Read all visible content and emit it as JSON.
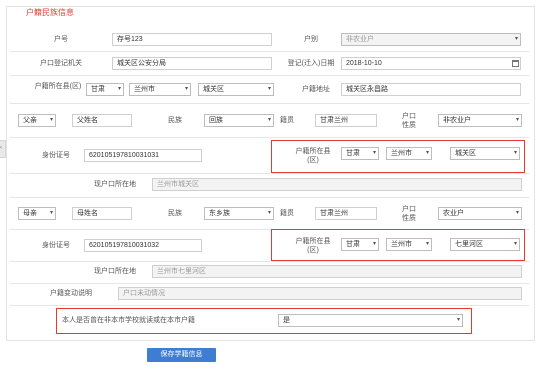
{
  "form_title": "户籍民族信息",
  "row1": {
    "huhao_label": "户号",
    "huhao_value": "存号123",
    "hubie_label": "户别",
    "hubie_value": "非农业户"
  },
  "row2": {
    "reg_office_label": "户口登记机关",
    "reg_office_value": "城关区公安分局",
    "reg_date_label": "登记(迁入)日期",
    "reg_date_value": "2018-10-10"
  },
  "row3": {
    "hukou_loc_label": "户籍所在县(区)",
    "province": "甘肃",
    "city": "兰州市",
    "district": "城关区",
    "hukou_nature_label": "户籍地址",
    "hukou_nature_value": "城关区永昌路"
  },
  "father": {
    "relation": "父亲",
    "name": "父姓名",
    "ethnicity_label": "民族",
    "ethnicity": "回族",
    "native_label": "籍贯",
    "native_value": "甘肃兰州",
    "hukou_label": "户口性质",
    "hukou_value": "非农业户"
  },
  "father_id": {
    "id_label": "身份证号",
    "id_value": "620105197810031031",
    "loc_label": "户籍所在县(区)",
    "province": "甘肃",
    "city": "兰州市",
    "district": "城关区"
  },
  "father_addr": {
    "label": "现户口所在地",
    "value": "兰州市城关区"
  },
  "mother": {
    "relation": "母亲",
    "name": "母姓名",
    "ethnicity_label": "民族",
    "ethnicity": "东乡族",
    "native_label": "籍贯",
    "native_value": "甘肃兰州",
    "hukou_label": "户口性质",
    "hukou_value": "农业户"
  },
  "mother_id": {
    "id_label": "身份证号",
    "id_value": "620105197810031032",
    "loc_label": "户籍所在县(区)",
    "province": "甘肃",
    "city": "兰州市",
    "district": "七里河区"
  },
  "mother_addr": {
    "label": "现户口所在地",
    "value": "兰州市七里河区"
  },
  "hukou_change": {
    "label": "户籍变动说明",
    "value": "户口未动情况"
  },
  "question": {
    "label": "本人是否曾在非本市学校就读或在本市户籍",
    "value": "是"
  },
  "save_label": "保存学籍信息",
  "colors": {
    "accent": "#3f7dd3",
    "highlight": "#e53935"
  }
}
